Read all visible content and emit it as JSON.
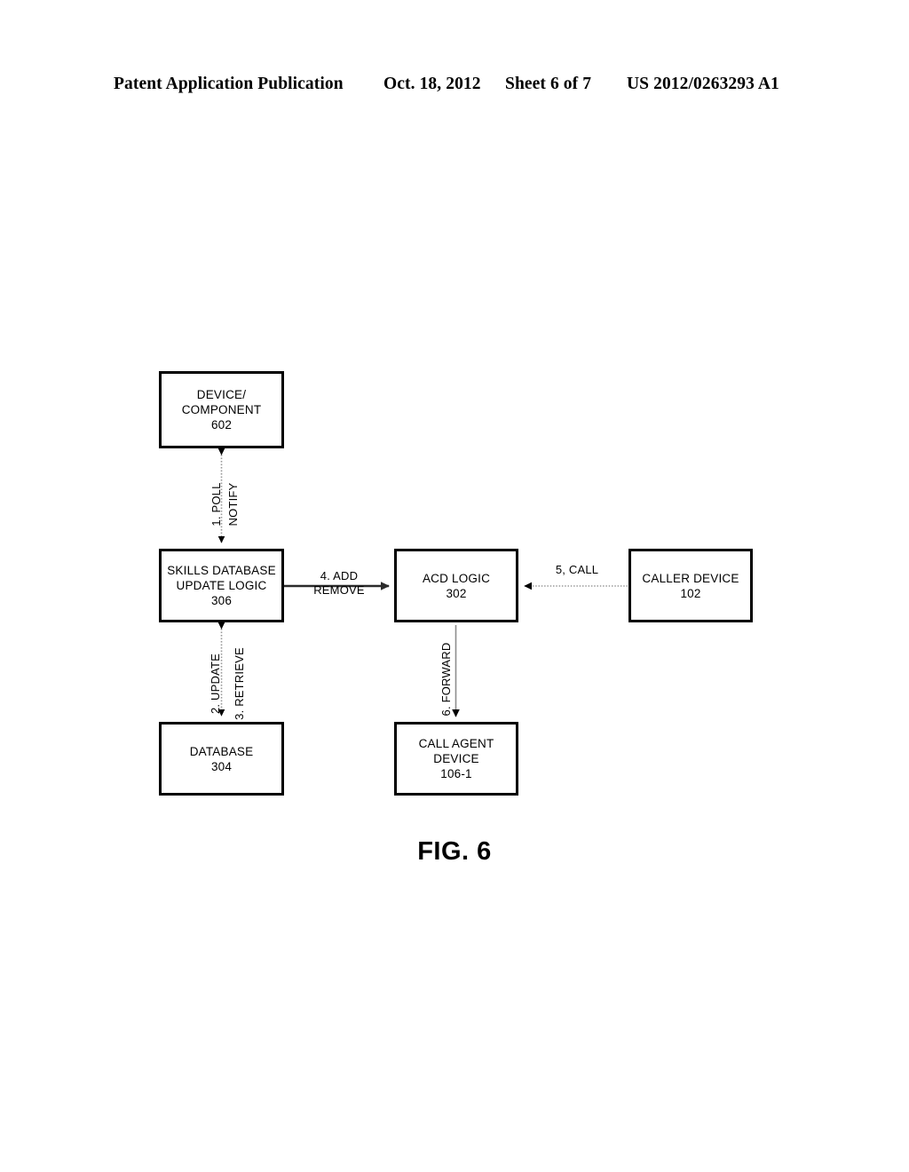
{
  "header": {
    "publication": "Patent Application Publication",
    "date": "Oct. 18, 2012",
    "sheet": "Sheet 6 of 7",
    "publication_number": "US 2012/0263293 A1"
  },
  "figure": {
    "caption": "FIG. 6"
  },
  "nodes": {
    "device_component": {
      "line1": "DEVICE/",
      "line2": "COMPONENT",
      "ref": "602"
    },
    "skills_database_update_logic": {
      "line1": "SKILLS DATABASE",
      "line2": "UPDATE LOGIC",
      "ref": "306"
    },
    "database": {
      "line1": "DATABASE",
      "ref": "304"
    },
    "acd_logic": {
      "line1": "ACD LOGIC",
      "ref": "302"
    },
    "call_agent_device": {
      "line1": "CALL AGENT",
      "line2": "DEVICE",
      "ref": "106-1"
    },
    "caller_device": {
      "line1": "CALLER DEVICE",
      "ref": "102"
    }
  },
  "edges": {
    "poll": "1. POLL",
    "notify": "NOTIFY",
    "update": "2. UPDATE",
    "retrieve": "3. RETRIEVE",
    "add": "4. ADD",
    "remove": "REMOVE",
    "call": "5, CALL",
    "forward": "6. FORWARD"
  },
  "colors": {
    "ink": "#000000",
    "paper": "#ffffff",
    "dotted_connector": "#9a9a9a",
    "solid_connector": "#3a3a3a"
  }
}
